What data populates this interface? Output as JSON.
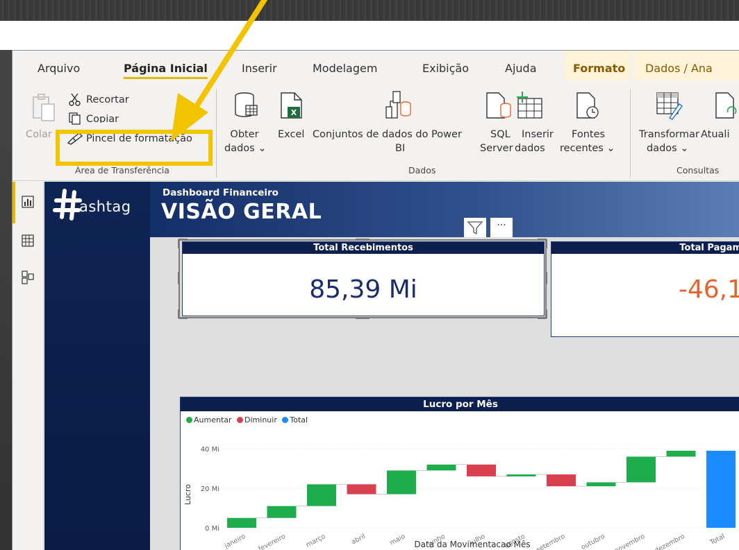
{
  "menu": {
    "tabs": [
      {
        "label": "Arquivo"
      },
      {
        "label": "Página Inicial"
      },
      {
        "label": "Inserir"
      },
      {
        "label": "Modelagem"
      },
      {
        "label": "Exibição"
      },
      {
        "label": "Ajuda"
      },
      {
        "label": "Formato"
      },
      {
        "label": "Dados / Ana"
      }
    ]
  },
  "ribbon": {
    "clipboard": {
      "paste": "Colar",
      "cut": "Recortar",
      "copy": "Copiar",
      "format_painter": "Pincel de formatação",
      "caption": "Área de Transferência"
    },
    "data": {
      "get_data_1": "Obter",
      "get_data_2": "dados",
      "excel": "Excel",
      "datasets_1": "Conjuntos de dados do Power",
      "datasets_2": "BI",
      "sql_1": "SQL",
      "sql_2": "Server",
      "enter_1": "Inserir",
      "enter_2": "dados",
      "recent_1": "Fontes",
      "recent_2": "recentes",
      "caption": "Dados"
    },
    "queries": {
      "transform_1": "Transformar",
      "transform_2": "dados",
      "refresh": "Atuali",
      "caption": "Consultas"
    }
  },
  "report": {
    "logo_text": "ashtag",
    "subtitle": "Dashboard Financeiro",
    "title": "VISÃO GERAL",
    "kpis": [
      {
        "title": "Total Recebimentos",
        "value": "85,39 Mi",
        "color": "#1a2c6b"
      },
      {
        "title": "Total Pagam",
        "value": "-46,1",
        "color": "#e8632b"
      }
    ]
  },
  "colors": {
    "increase": "#1fac4c",
    "decrease": "#d8404f",
    "total": "#1a8cff",
    "accent": "#e5b700",
    "highlight": "#f2c400"
  },
  "chart_data": {
    "type": "waterfall",
    "title": "Lucro por Mês",
    "xlabel": "Data da Movimentacao Mês",
    "ylabel": "Lucro",
    "legend": [
      "Aumentar",
      "Diminuir",
      "Total"
    ],
    "y_ticks": [
      "40 Mi",
      "20 Mi",
      "0 Mi"
    ],
    "ylim": [
      0,
      40
    ],
    "categories": [
      "janeiro",
      "fevereiro",
      "março",
      "abril",
      "maio",
      "junho",
      "julho",
      "agosto",
      "setembro",
      "outubro",
      "novembro",
      "dezembro",
      "Total"
    ],
    "bars": [
      {
        "start": 0,
        "end": 5,
        "kind": "increase"
      },
      {
        "start": 5,
        "end": 11,
        "kind": "increase"
      },
      {
        "start": 11,
        "end": 22,
        "kind": "increase"
      },
      {
        "start": 22,
        "end": 17,
        "kind": "decrease"
      },
      {
        "start": 17,
        "end": 29,
        "kind": "increase"
      },
      {
        "start": 29,
        "end": 32,
        "kind": "increase"
      },
      {
        "start": 32,
        "end": 26,
        "kind": "decrease"
      },
      {
        "start": 26,
        "end": 27,
        "kind": "increase"
      },
      {
        "start": 27,
        "end": 21,
        "kind": "decrease"
      },
      {
        "start": 21,
        "end": 23,
        "kind": "increase"
      },
      {
        "start": 23,
        "end": 36,
        "kind": "increase"
      },
      {
        "start": 36,
        "end": 39,
        "kind": "increase"
      },
      {
        "start": 0,
        "end": 39,
        "kind": "total"
      }
    ]
  }
}
